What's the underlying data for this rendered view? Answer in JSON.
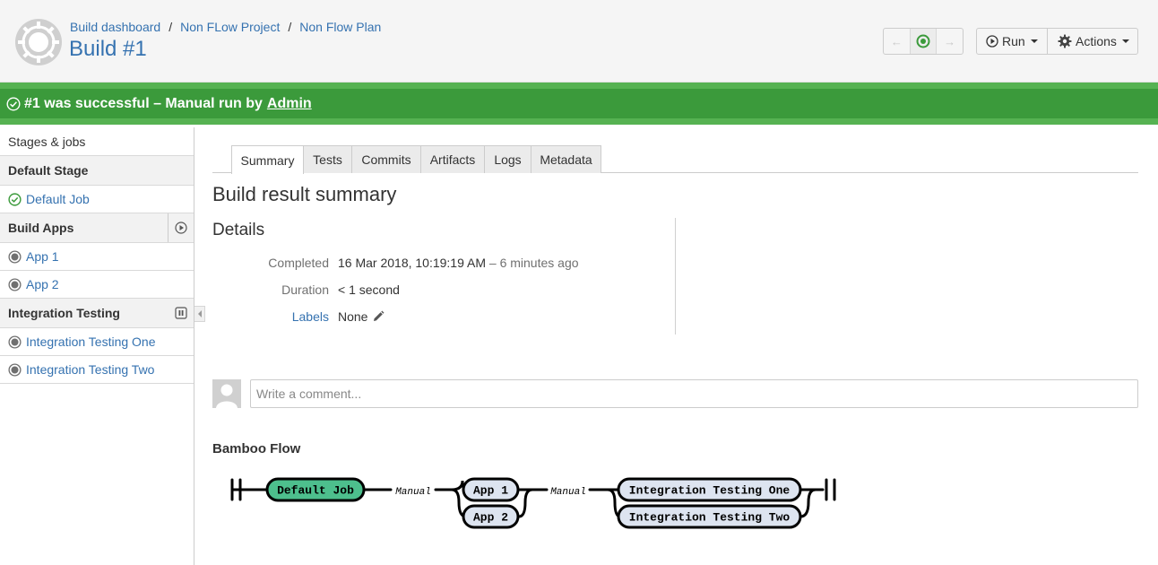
{
  "breadcrumbs": [
    "Build dashboard",
    "Non FLow Project",
    "Non Flow Plan"
  ],
  "build_title": "Build #1",
  "toolbar": {
    "run_label": "Run",
    "actions_label": "Actions"
  },
  "status": {
    "text": "#1 was successful – Manual run by",
    "user": "Admin"
  },
  "sidebar": {
    "heading": "Stages & jobs",
    "stage1": "Default Stage",
    "job_default": "Default Job",
    "stage2": "Build Apps",
    "job_app1": "App 1",
    "job_app2": "App 2",
    "stage3": "Integration Testing",
    "job_it1": "Integration Testing One",
    "job_it2": "Integration Testing Two"
  },
  "tabs": [
    "Summary",
    "Tests",
    "Commits",
    "Artifacts",
    "Logs",
    "Metadata"
  ],
  "page_title": "Build result summary",
  "details": {
    "title": "Details",
    "completed_label": "Completed",
    "completed_value": "16 Mar 2018, 10:19:19 AM",
    "completed_ago": "– 6 minutes ago",
    "duration_label": "Duration",
    "duration_value": "< 1 second",
    "labels_label": "Labels",
    "labels_value": "None"
  },
  "comment": {
    "placeholder": "Write a comment..."
  },
  "flow": {
    "title": "Bamboo Flow",
    "job_default": "Default Job",
    "manual_1": "Manual",
    "job_app1": "App 1",
    "job_app2": "App 2",
    "manual_2": "Manual",
    "job_it1": "Integration Testing One",
    "job_it2": "Integration Testing Two"
  },
  "colors": {
    "success_green": "#3b9a3b",
    "link_blue": "#3572b0",
    "flow_done": "#4dbf8d",
    "flow_pending": "#dde4f0"
  },
  "icons": {
    "logo": "bamboo-logo-icon",
    "run": "play-circle-icon",
    "actions": "gear-icon",
    "status": "check-circle-icon",
    "labels_edit": "pencil-icon"
  }
}
